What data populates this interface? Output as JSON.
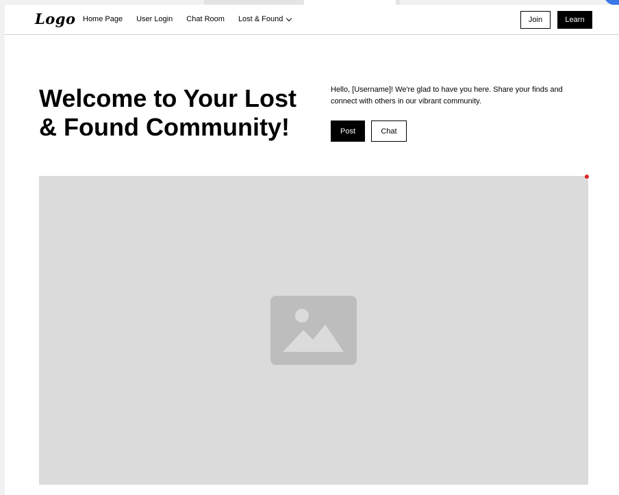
{
  "nav": {
    "logo": "Logo",
    "links": [
      "Home Page",
      "User Login",
      "Chat Room"
    ],
    "dropdown_label": "Lost & Found",
    "join_label": "Join",
    "learn_label": "Learn"
  },
  "hero": {
    "title": "Welcome to Your Lost & Found Community!",
    "text": "Hello, [Username]! We're glad to have you here. Share your finds and connect with others in our vibrant community.",
    "post_label": "Post",
    "chat_label": "Chat"
  },
  "media": {
    "icon": "image-placeholder-icon"
  },
  "colors": {
    "primary": "#000000",
    "placeholder_bg": "#dbdbdb",
    "placeholder_icon": "#bdbdbd",
    "indicator": "#e02020"
  }
}
